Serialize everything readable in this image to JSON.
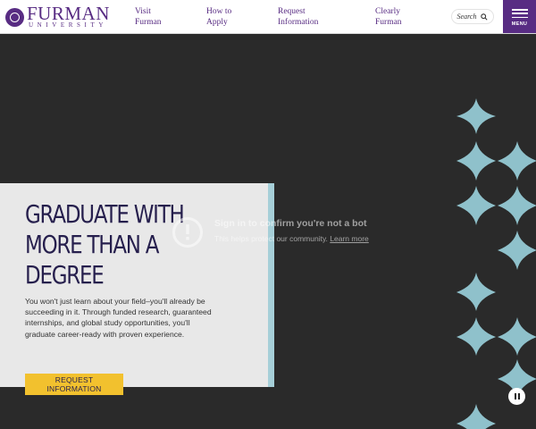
{
  "header": {
    "logo": {
      "word": "FURMAN",
      "sub": "UNIVERSITY"
    },
    "nav": [
      {
        "label": "Visit\nFurman"
      },
      {
        "label": "How to\nApply"
      },
      {
        "label": "Request\nInformation"
      },
      {
        "label": "Clearly\nFurman"
      }
    ],
    "search": {
      "label": "Search",
      "icon": "search-icon"
    },
    "menu": {
      "label": "MENU",
      "icon": "hamburger-icon"
    }
  },
  "hero": {
    "headline": "GRADUATE WITH MORE THAN A DEGREE",
    "body": "You won't just learn about your field–you'll already be succeeding in it. Through funded research, guaranteed internships, and global study opportunities, you'll graduate career-ready with proven experience.",
    "cta": "REQUEST INFORMATION"
  },
  "bot_check": {
    "icon": "alert-circle-icon",
    "title": "Sign in to confirm you're not a bot",
    "subtitle": "This helps protect our community.",
    "link": "Learn more"
  },
  "video_control": {
    "icon": "pause-icon"
  },
  "colors": {
    "brand_purple": "#582c83",
    "navy": "#261f4d",
    "cta_yellow": "#f2c12e",
    "accent_blue": "#a6cfd8",
    "diamond": "#8fc1cb",
    "background": "#2a2a2a",
    "panel": "#e8e8e8"
  }
}
